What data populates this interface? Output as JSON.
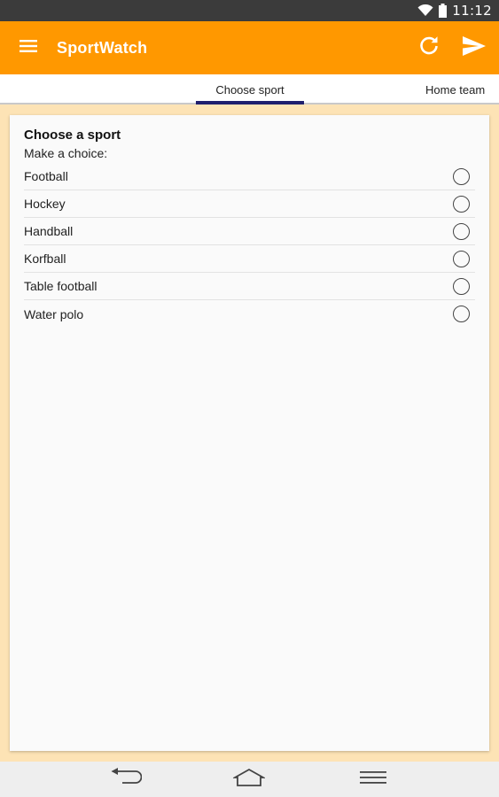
{
  "status_bar": {
    "time": "11:12",
    "icons": [
      "wifi-icon",
      "battery-icon"
    ]
  },
  "app_bar": {
    "title": "SportWatch",
    "icons": [
      "menu-icon",
      "refresh-icon",
      "send-icon"
    ],
    "background_color": "#ff9800"
  },
  "tabs": [
    {
      "label": "Choose sport",
      "selected": true
    },
    {
      "label": "Home team",
      "selected": false
    }
  ],
  "card": {
    "title": "Choose a sport",
    "subtitle": "Make a choice:",
    "options": [
      {
        "label": "Football",
        "checked": false
      },
      {
        "label": "Hockey",
        "checked": false
      },
      {
        "label": "Handball",
        "checked": false
      },
      {
        "label": "Korfball",
        "checked": false
      },
      {
        "label": "Table football",
        "checked": false
      },
      {
        "label": "Water polo",
        "checked": false
      }
    ]
  },
  "nav_bar": {
    "icons": [
      "back-icon",
      "home-icon",
      "menu-lines-icon"
    ]
  }
}
